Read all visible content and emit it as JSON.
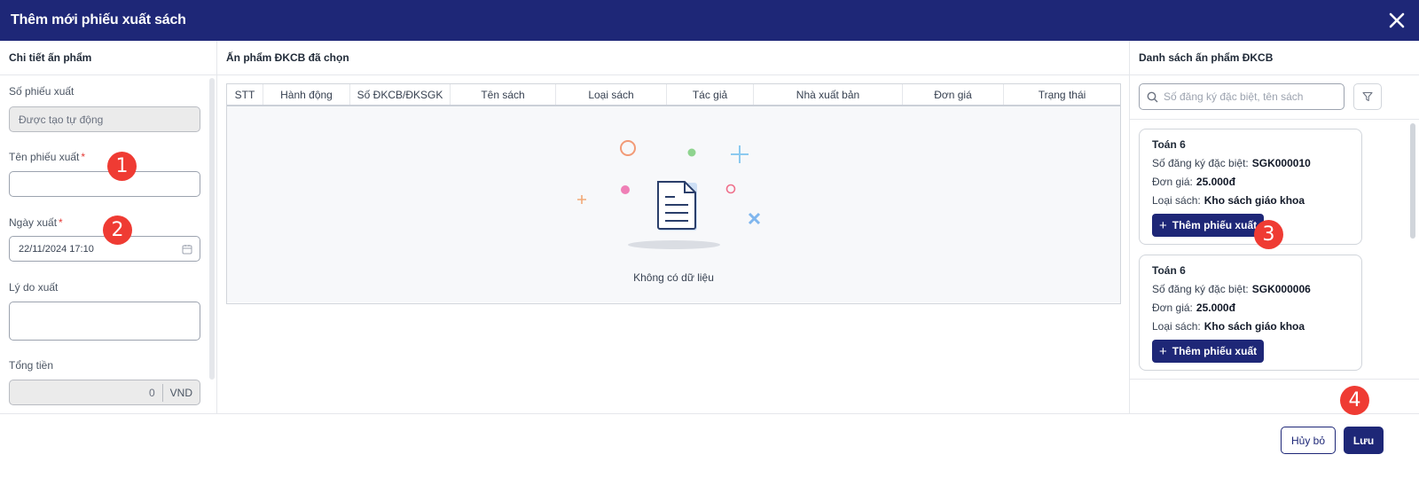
{
  "dialog": {
    "title": "Thêm mới phiếu xuất sách"
  },
  "left": {
    "heading": "Chi tiết ấn phẩm",
    "fields": {
      "code_label": "Số phiếu xuất",
      "code_value": "Được tạo tự động",
      "name_label": "Tên phiếu xuất",
      "name_value": "",
      "date_label": "Ngày xuất",
      "date_value": "22/11/2024 17:10",
      "reason_label": "Lý do xuất",
      "reason_value": "",
      "total_label": "Tổng tiền",
      "total_value": "0",
      "total_unit": "VND"
    }
  },
  "middle": {
    "heading": "Ấn phẩm ĐKCB đã chọn",
    "columns": [
      "STT",
      "Hành động",
      "Số ĐKCB/ĐKSGK",
      "Tên sách",
      "Loại sách",
      "Tác giả",
      "Nhà xuất bản",
      "Đơn giá",
      "Trạng thái"
    ],
    "empty_text": "Không có dữ liệu"
  },
  "right": {
    "heading": "Danh sách ấn phẩm ĐKCB",
    "search_placeholder": "Số đăng ký đặc biệt, tên sách",
    "items": [
      {
        "name": "Toán 6",
        "code_label": "Số đăng ký đặc biệt:",
        "code": "SGK000010",
        "price_label": "Đơn giá:",
        "price": "25.000đ",
        "type_label": "Loại sách:",
        "type": "Kho sách giáo khoa",
        "button": "Thêm phiếu xuất"
      },
      {
        "name": "Toán 6",
        "code_label": "Số đăng ký đặc biệt:",
        "code": "SGK000006",
        "price_label": "Đơn giá:",
        "price": "25.000đ",
        "type_label": "Loại sách:",
        "type": "Kho sách giáo khoa",
        "button": "Thêm phiếu xuất"
      }
    ]
  },
  "footer": {
    "cancel": "Hủy bỏ",
    "save": "Lưu"
  },
  "badges": [
    "1",
    "2",
    "3",
    "4"
  ],
  "colors": {
    "primary": "#1e2777",
    "badge": "#ef3b33",
    "required": "#e53935"
  }
}
